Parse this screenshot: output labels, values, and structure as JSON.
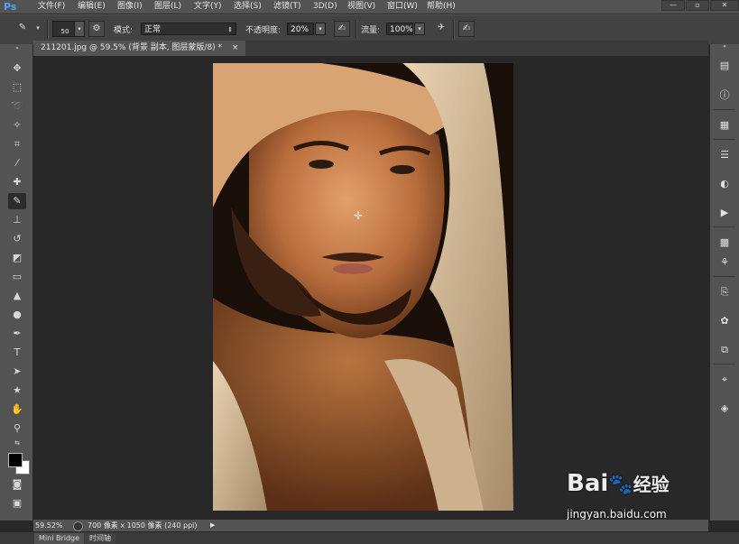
{
  "menubar": {
    "logo": "Ps",
    "items": [
      "文件(F)",
      "编辑(E)",
      "图像(I)",
      "图层(L)",
      "文字(Y)",
      "选择(S)",
      "滤镜(T)",
      "3D(D)",
      "视图(V)",
      "窗口(W)",
      "帮助(H)"
    ]
  },
  "options": {
    "brush_size": "50",
    "mode_label": "模式:",
    "mode_value": "正常",
    "opacity_label": "不透明度:",
    "opacity_value": "20%",
    "flow_label": "流量:",
    "flow_value": "100%"
  },
  "document": {
    "tab_title": "211201.jpg @ 59.5% (背景 副本, 图层蒙版/8) *",
    "close_glyph": "×"
  },
  "status": {
    "zoom": "59.52%",
    "info": "700 像素 x 1050 像素 (240 ppi)"
  },
  "bottom_tabs": [
    "Mini Bridge",
    "时间轴"
  ],
  "watermark": {
    "brand": "Bai",
    "brand2": "经验",
    "url": "jingyan.baidu.com"
  }
}
